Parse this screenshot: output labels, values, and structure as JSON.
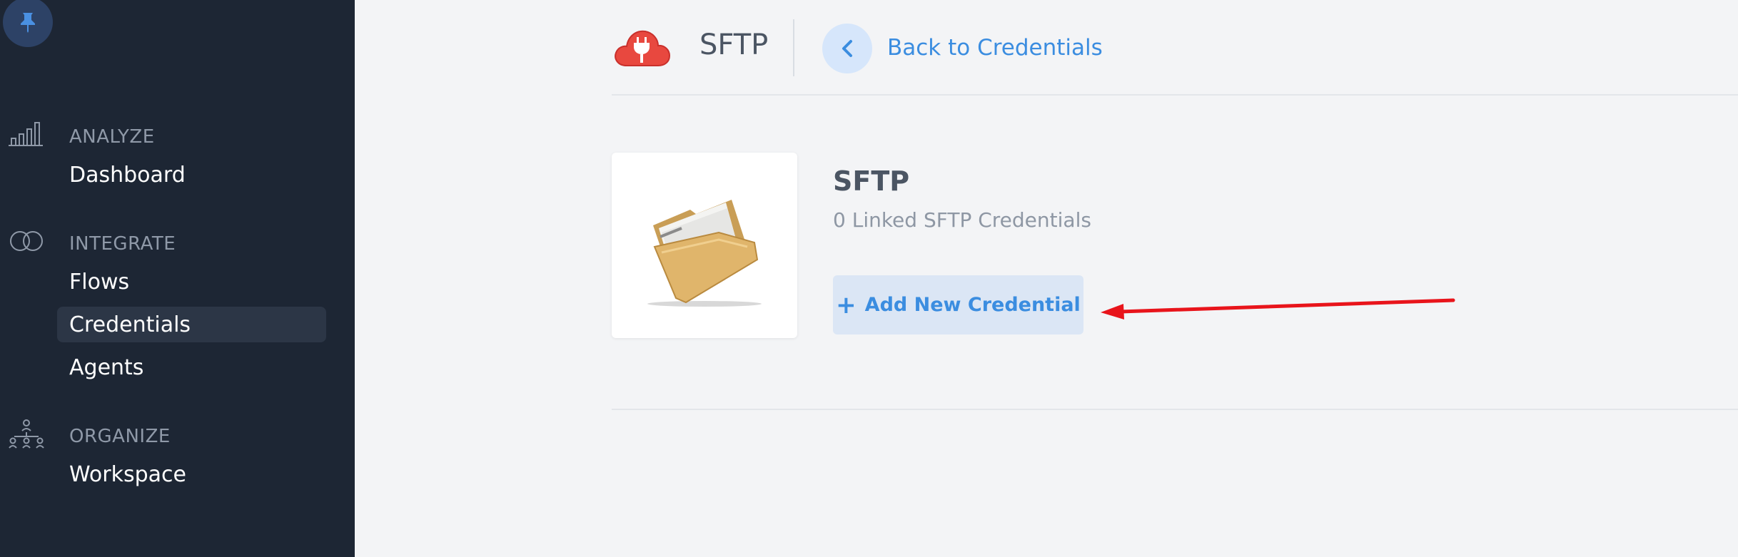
{
  "sidebar": {
    "sections": [
      {
        "label": "ANALYZE",
        "icon": "bar-chart-icon",
        "items": [
          "Dashboard"
        ]
      },
      {
        "label": "INTEGRATE",
        "icon": "linked-rings-icon",
        "items": [
          "Flows",
          "Credentials",
          "Agents"
        ]
      },
      {
        "label": "ORGANIZE",
        "icon": "org-chart-icon",
        "items": [
          "Workspace"
        ]
      }
    ],
    "active_item": "Credentials"
  },
  "header": {
    "title": "SFTP",
    "back_label": "Back to Credentials"
  },
  "connector": {
    "name": "SFTP",
    "linked_count_text": "0 Linked SFTP Credentials",
    "add_button_label": "Add New Credential",
    "image": "folder-icon"
  },
  "colors": {
    "sidebar_bg": "#1d2634",
    "accent": "#3b8de0",
    "logo_red": "#e8483f",
    "annotation_arrow": "#e8141b"
  }
}
